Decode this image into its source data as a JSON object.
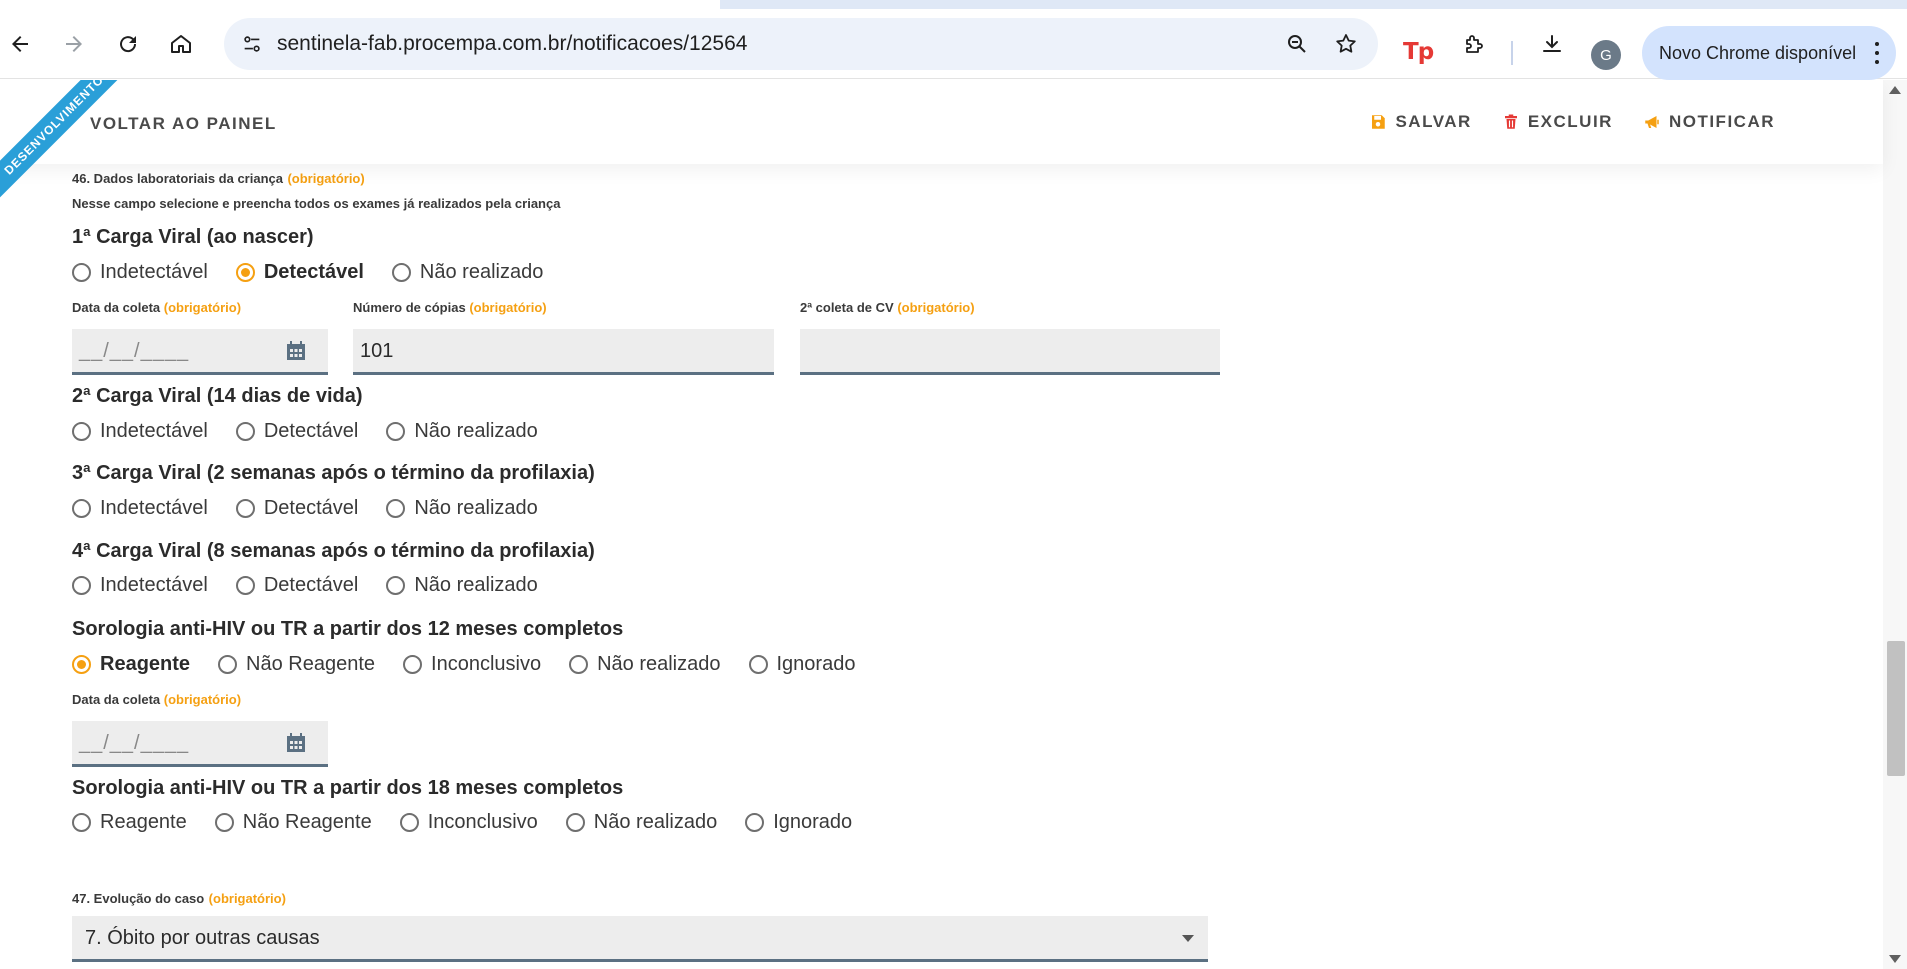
{
  "browser": {
    "url": "sentinela-fab.procempa.com.br/notificacoes/12564",
    "extension_label": "Tp",
    "avatar_initial": "G",
    "update_chip": "Novo Chrome disponível"
  },
  "appbar": {
    "ribbon": "DESENVOLVIMENTO",
    "back": "VOLTAR AO PAINEL",
    "save": "SALVAR",
    "delete": "EXCLUIR",
    "notify": "NOTIFICAR"
  },
  "form": {
    "q46": {
      "title": "46. Dados laboratoriais da criança",
      "required": "(obrigatório)",
      "hint": "Nesse campo selecione e preencha todos os exames já realizados pela criança"
    },
    "cv1": {
      "title": "1ª Carga Viral (ao nascer)",
      "options": [
        "Indetectável",
        "Detectável",
        "Não realizado"
      ],
      "selected": "Detectável",
      "date_label": "Data da coleta",
      "date_placeholder": "__/__/____",
      "copies_label": "Número de cópias",
      "copies_value": "101",
      "second_label": "2ª coleta de CV",
      "second_value": "",
      "required": "(obrigatório)"
    },
    "cv2": {
      "title": "2ª Carga Viral (14 dias de vida)",
      "options": [
        "Indetectável",
        "Detectável",
        "Não realizado"
      ]
    },
    "cv3": {
      "title": "3ª Carga Viral (2 semanas após o término da profilaxia)",
      "options": [
        "Indetectável",
        "Detectável",
        "Não realizado"
      ]
    },
    "cv4": {
      "title": "4ª Carga Viral (8 semanas após o término da profilaxia)",
      "options": [
        "Indetectável",
        "Detectável",
        "Não realizado"
      ]
    },
    "sero12": {
      "title": "Sorologia anti-HIV ou TR a partir dos 12 meses completos",
      "options": [
        "Reagente",
        "Não Reagente",
        "Inconclusivo",
        "Não realizado",
        "Ignorado"
      ],
      "selected": "Reagente",
      "date_label": "Data da coleta",
      "date_placeholder": "__/__/____",
      "required": "(obrigatório)"
    },
    "sero18": {
      "title": "Sorologia anti-HIV ou TR a partir dos 18 meses completos",
      "options": [
        "Reagente",
        "Não Reagente",
        "Inconclusivo",
        "Não realizado",
        "Ignorado"
      ]
    },
    "q47": {
      "title": "47. Evolução do caso",
      "required": "(obrigatório)",
      "selected": "7. Óbito por outras causas"
    }
  },
  "colors": {
    "accent": "#f5a012",
    "ribbon": "#2a9fd8",
    "field_border": "#5b7082"
  }
}
